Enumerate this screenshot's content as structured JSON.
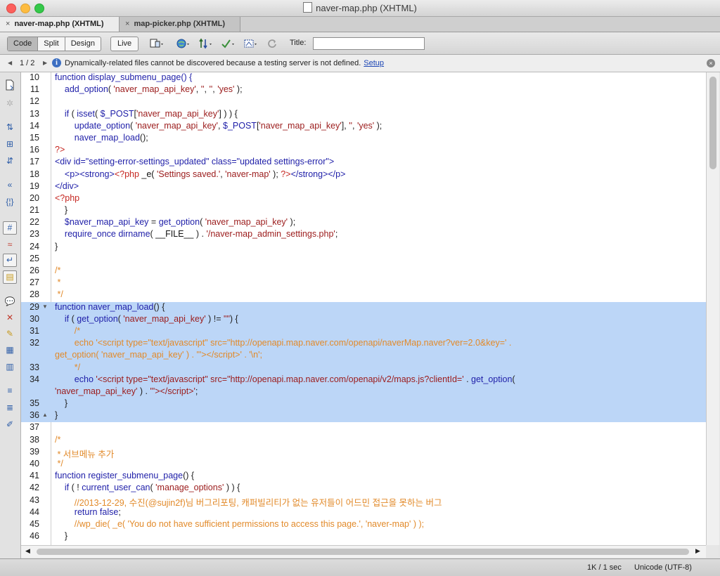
{
  "window": {
    "title": "naver-map.php (XHTML)"
  },
  "tabs": [
    {
      "label": "naver-map.php (XHTML)",
      "close": "×"
    },
    {
      "label": "map-picker.php (XHTML)",
      "close": "×"
    }
  ],
  "toolbar": {
    "views": [
      "Code",
      "Split",
      "Design"
    ],
    "live_label": "Live",
    "title_label": "Title:",
    "title_value": "",
    "icons": [
      "multiscreen-icon",
      "preview-globe-icon",
      "file-management-icon",
      "validate-icon",
      "visual-aids-icon",
      "refresh-icon"
    ]
  },
  "infobar": {
    "prev": "◀",
    "next": "▶",
    "count": "1 / 2",
    "info_glyph": "i",
    "message": "Dynamically-related files cannot be discovered because a testing server is not defined.",
    "link": "Setup",
    "close": "×"
  },
  "editor": {
    "lines": [
      {
        "n": "10",
        "fold": "",
        "sel": false,
        "html": "<span class='kw'>function</span> <span class='kw'>display_submenu_page</span><span class='kw'>() {</span>"
      },
      {
        "n": "11",
        "fold": "",
        "sel": false,
        "html": "    <span class='kw'>add_option</span>( <span class='str'>'naver_map_api_key'</span>, <span class='str'>''</span>, <span class='str'>''</span>, <span class='str'>'yes'</span> );"
      },
      {
        "n": "12",
        "fold": "",
        "sel": false,
        "html": ""
      },
      {
        "n": "13",
        "fold": "",
        "sel": false,
        "html": "    <span class='kw'>if</span> ( <span class='kw'>isset</span>( <span class='var'>$_POST</span>[<span class='str'>'naver_map_api_key'</span>] ) ) {"
      },
      {
        "n": "14",
        "fold": "",
        "sel": false,
        "html": "        <span class='kw'>update_option</span>( <span class='str'>'naver_map_api_key'</span>, <span class='var'>$_POST</span>[<span class='str'>'naver_map_api_key'</span>], <span class='str'>''</span>, <span class='str'>'yes'</span> );"
      },
      {
        "n": "15",
        "fold": "",
        "sel": false,
        "html": "        <span class='kw'>naver_map_load</span>();"
      },
      {
        "n": "16",
        "fold": "",
        "sel": false,
        "html": "<span class='php'>?&gt;</span>"
      },
      {
        "n": "17",
        "fold": "",
        "sel": false,
        "html": "<span class='tag'>&lt;div id=\"setting-error-settings_updated\" class=\"updated settings-error\"&gt;</span>"
      },
      {
        "n": "18",
        "fold": "",
        "sel": false,
        "html": "    <span class='tag'>&lt;p&gt;&lt;strong&gt;</span><span class='php'>&lt;?php</span> <span class='plain'>_e(</span> <span class='str'>'Settings saved.'</span>, <span class='str'>'naver-map'</span> ); <span class='php'>?&gt;</span><span class='tag'>&lt;/strong&gt;&lt;/p&gt;</span>"
      },
      {
        "n": "19",
        "fold": "",
        "sel": false,
        "html": "<span class='tag'>&lt;/div&gt;</span>"
      },
      {
        "n": "20",
        "fold": "",
        "sel": false,
        "html": "<span class='php'>&lt;?php</span>"
      },
      {
        "n": "21",
        "fold": "",
        "sel": false,
        "html": "    }"
      },
      {
        "n": "22",
        "fold": "",
        "sel": false,
        "html": "    <span class='var'>$naver_map_api_key</span> = <span class='kw'>get_option</span>( <span class='str'>'naver_map_api_key'</span> );"
      },
      {
        "n": "23",
        "fold": "",
        "sel": false,
        "html": "    <span class='kw'>require_once</span> <span class='kw'>dirname</span>( <span class='plain'>__FILE__</span> ) . <span class='str'>'/naver-map_admin_settings.php'</span>;"
      },
      {
        "n": "24",
        "fold": "",
        "sel": false,
        "html": "}"
      },
      {
        "n": "25",
        "fold": "",
        "sel": false,
        "html": ""
      },
      {
        "n": "26",
        "fold": "",
        "sel": false,
        "html": "<span class='com'>/*</span>"
      },
      {
        "n": "27",
        "fold": "",
        "sel": false,
        "html": "<span class='com'> *</span>"
      },
      {
        "n": "28",
        "fold": "",
        "sel": false,
        "html": "<span class='com'> */</span>"
      },
      {
        "n": "29",
        "fold": "▼",
        "sel": true,
        "html": "<span class='kw'>function</span> <span class='kw'>naver_map_load</span>() {"
      },
      {
        "n": "30",
        "fold": "",
        "sel": true,
        "html": "    <span class='kw'>if</span> ( <span class='kw'>get_option</span>( <span class='str'>'naver_map_api_key'</span> ) != <span class='str'>\"\"</span>) {"
      },
      {
        "n": "31",
        "fold": "",
        "sel": true,
        "html": "        <span class='com'>/*</span>"
      },
      {
        "n": "32",
        "fold": "",
        "sel": true,
        "html": "        <span class='com'>echo '&lt;script type=\"text/javascript\" src=\"http://openapi.map.naver.com/openapi/naverMap.naver?ver=2.0&amp;key=' .</span>"
      },
      {
        "n": "",
        "fold": "",
        "sel": true,
        "html": "<span class='com'>get_option( 'naver_map_api_key' ) . '\"&gt;&lt;/script&gt;' . '\\n';</span>"
      },
      {
        "n": "33",
        "fold": "",
        "sel": true,
        "html": "        <span class='com'>*/</span>"
      },
      {
        "n": "34",
        "fold": "",
        "sel": true,
        "html": "        <span class='kw'>echo</span> <span class='str'>'&lt;script type=\"text/javascript\" src=\"http://openapi.map.naver.com/openapi/v2/maps.js?clientId='</span> . <span class='kw'>get_option</span>("
      },
      {
        "n": "",
        "fold": "",
        "sel": true,
        "html": "<span class='str'>'naver_map_api_key'</span> ) . <span class='str'>'\"&gt;&lt;/script&gt;'</span>;"
      },
      {
        "n": "35",
        "fold": "",
        "sel": true,
        "html": "    }"
      },
      {
        "n": "36",
        "fold": "▲",
        "sel": true,
        "html": "}"
      },
      {
        "n": "37",
        "fold": "",
        "sel": false,
        "html": ""
      },
      {
        "n": "38",
        "fold": "",
        "sel": false,
        "html": "<span class='com'>/*</span>"
      },
      {
        "n": "39",
        "fold": "",
        "sel": false,
        "html": "<span class='com'> * 서브메뉴 추가</span>"
      },
      {
        "n": "40",
        "fold": "",
        "sel": false,
        "html": "<span class='com'> */</span>"
      },
      {
        "n": "41",
        "fold": "",
        "sel": false,
        "html": "<span class='kw'>function</span> <span class='kw'>register_submenu_page</span>() {"
      },
      {
        "n": "42",
        "fold": "",
        "sel": false,
        "html": "    <span class='kw'>if</span> ( ! <span class='kw'>current_user_can</span>( <span class='str'>'manage_options'</span> ) ) {"
      },
      {
        "n": "43",
        "fold": "",
        "sel": false,
        "html": "        <span class='com'>//2013-12-29, 수진(@sujin2f)님 버그리포팅, 캐퍼빌리티가 없는 유저들이 어드민 접근을 못하는 버그</span>"
      },
      {
        "n": "44",
        "fold": "",
        "sel": false,
        "html": "        <span class='kw'>return false</span>;"
      },
      {
        "n": "45",
        "fold": "",
        "sel": false,
        "html": "        <span class='com'>//wp_die( _e( 'You do not have sufficient permissions to access this page.', 'naver-map' ) );</span>"
      },
      {
        "n": "46",
        "fold": "",
        "sel": false,
        "html": "    }"
      }
    ]
  },
  "left_tools": [
    "open-documents-icon",
    "collapse-full-tag-icon",
    "collapse-selection-icon",
    "expand-all-icon",
    "select-parent-tag-icon",
    "balance-braces-icon",
    "line-numbers-icon",
    "highlight-invalid-code-icon",
    "word-wrap-icon",
    "syntax-coloring-icon",
    "apply-comment-icon",
    "remove-comment-icon",
    "wrap-tag-icon",
    "recent-snippets-icon",
    "indent-icon",
    "outdent-icon",
    "format-source-icon"
  ],
  "scroll": {
    "up": "▲",
    "down": "▼",
    "left": "◀",
    "right": "▶"
  },
  "status": {
    "size": "1K / 1 sec",
    "encoding": "Unicode (UTF-8)"
  }
}
